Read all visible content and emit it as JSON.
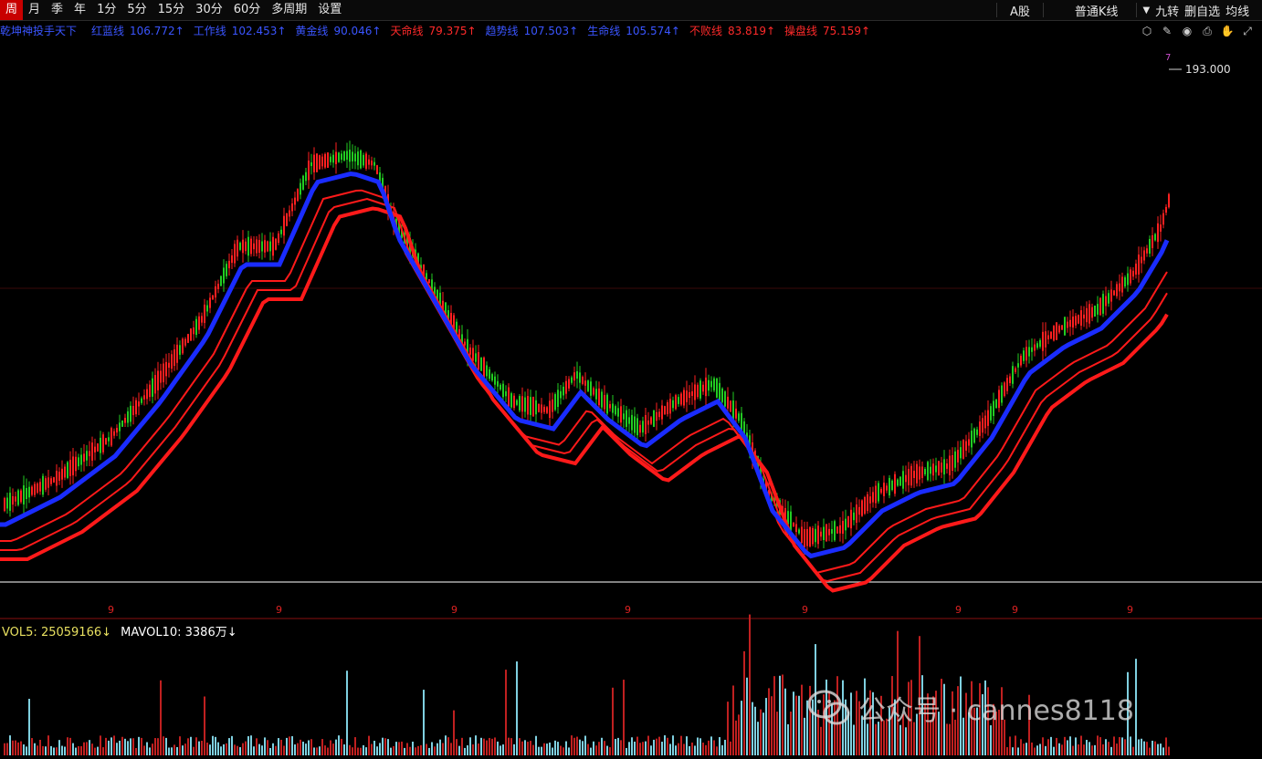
{
  "toolbar": {
    "tabs": [
      "周",
      "月",
      "季",
      "年",
      "1分",
      "5分",
      "15分",
      "30分",
      "60分",
      "多周期",
      "设置"
    ],
    "market_label": "A股",
    "kline_type": "普通K线",
    "right_buttons": [
      "九转",
      "删自选",
      "均线"
    ]
  },
  "indicators": [
    {
      "label": "乾坤神投手天下",
      "value": "",
      "color": "#3a55ff"
    },
    {
      "label": "红蓝线",
      "value": "106.772↑",
      "color": "#3a55ff"
    },
    {
      "label": "工作线",
      "value": "102.453↑",
      "color": "#3a55ff"
    },
    {
      "label": "黄金线",
      "value": "90.046↑",
      "color": "#3a55ff"
    },
    {
      "label": "天命线",
      "value": "79.375↑",
      "color": "#ff2a2a"
    },
    {
      "label": "趋势线",
      "value": "107.503↑",
      "color": "#3a55ff"
    },
    {
      "label": "生命线",
      "value": "105.574↑",
      "color": "#3a55ff"
    },
    {
      "label": "不败线",
      "value": "83.819↑",
      "color": "#ff2a2a"
    },
    {
      "label": "操盘线",
      "value": "75.159↑",
      "color": "#ff2a2a"
    }
  ],
  "chart_tools": [
    "draw-settings-icon",
    "pencil-icon",
    "eye-icon",
    "printer-icon",
    "hand-icon",
    "expand-icon"
  ],
  "price": {
    "max_label": "193.000",
    "top_marker": "7",
    "nine_labels": [
      "9",
      "9",
      "9",
      "9",
      "9",
      "9",
      "9",
      "9"
    ]
  },
  "volume": {
    "mavol5_label": "VOL5:",
    "mavol5_value": "25059166↓",
    "mavol10_label": "MAVOL10:",
    "mavol10_value": "3386万↓"
  },
  "watermark": "公众号 · cannes8118",
  "colors": {
    "up": "#ff2020",
    "down": "#22cc22",
    "blue_line": "#1a2cff",
    "red_line": "#ff1a1a",
    "indicator_blue": "#3a55ff",
    "vol5": "#e8e060",
    "vol10": "#ffffff"
  }
}
